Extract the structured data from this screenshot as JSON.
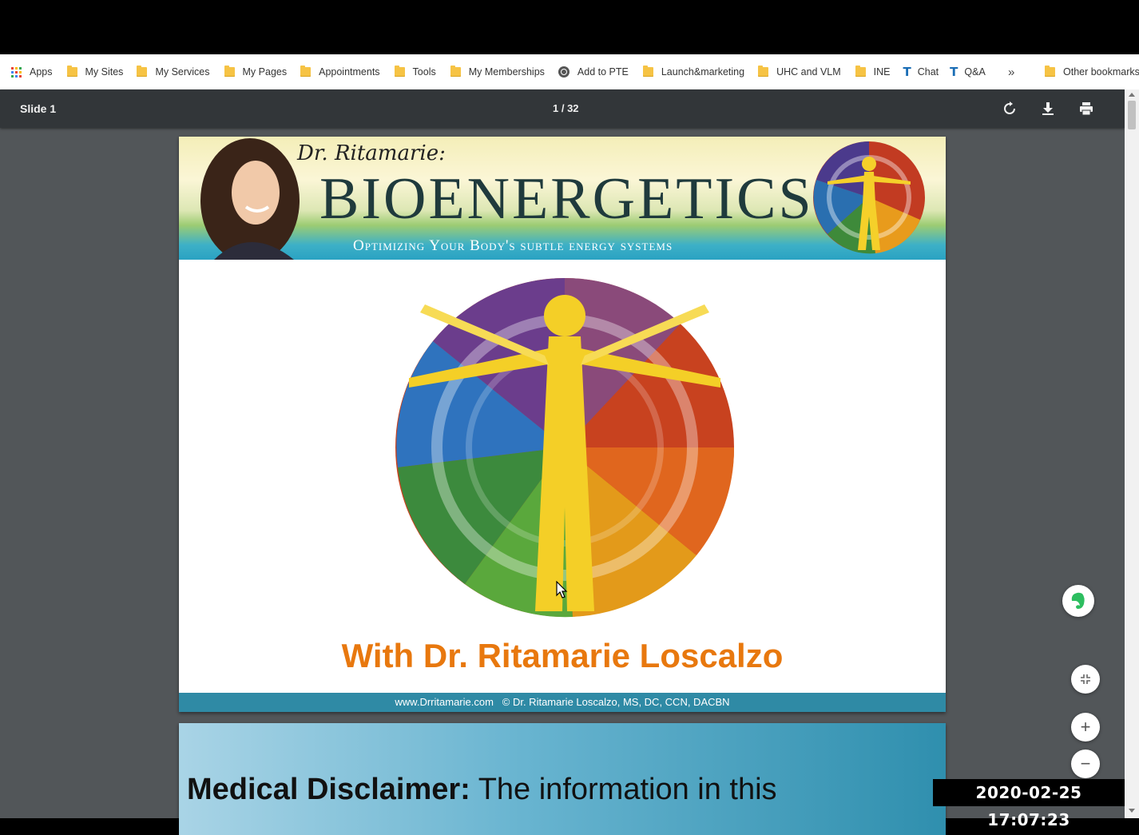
{
  "bookmarks": {
    "items": [
      {
        "label": "Apps",
        "icon": "apps-grid-icon"
      },
      {
        "label": "My Sites",
        "icon": "folder-icon"
      },
      {
        "label": "My Services",
        "icon": "folder-icon"
      },
      {
        "label": "My Pages",
        "icon": "folder-icon"
      },
      {
        "label": "Appointments",
        "icon": "folder-icon"
      },
      {
        "label": "Tools",
        "icon": "folder-icon"
      },
      {
        "label": "My Memberships",
        "icon": "folder-icon"
      },
      {
        "label": "Add to PTE",
        "icon": "globe-icon"
      },
      {
        "label": "Launch&marketing",
        "icon": "folder-icon"
      },
      {
        "label": "UHC and VLM",
        "icon": "folder-icon"
      },
      {
        "label": "INE",
        "icon": "folder-icon"
      },
      {
        "label": "Chat",
        "icon": "tt-icon"
      },
      {
        "label": "Q&A",
        "icon": "tt-icon"
      }
    ],
    "more": "»",
    "other": "Other bookmarks"
  },
  "pdf_toolbar": {
    "title": "Slide 1",
    "page_indicator": "1 / 32",
    "rotate_icon": "rotate-icon",
    "download_icon": "download-icon",
    "print_icon": "print-icon"
  },
  "slide1": {
    "banner_byline": "Dr. Ritamarie:",
    "banner_title": "BIOENERGETICS",
    "banner_subtitle": "Optimizing Your Body's subtle energy systems",
    "heading": "With Dr. Ritamarie Loscalzo",
    "footer_site": "www.Drritamarie.com",
    "footer_copy": "© Dr. Ritamarie Loscalzo, MS, DC, CCN, DACBN"
  },
  "slide2": {
    "bold_text": "Medical Disclaimer:",
    "text": " The information in this"
  },
  "controls": {
    "fit_icon": "fit-page-icon",
    "zoom_in": "+",
    "zoom_out": "−",
    "evernote_icon": "evernote-icon"
  },
  "timestamp": "2020-02-25  17:07:23",
  "colors": {
    "toolbar": "#323639",
    "viewer_bg": "#525659",
    "heading_orange": "#e8780e",
    "footer_teal": "#2f8aa5"
  }
}
